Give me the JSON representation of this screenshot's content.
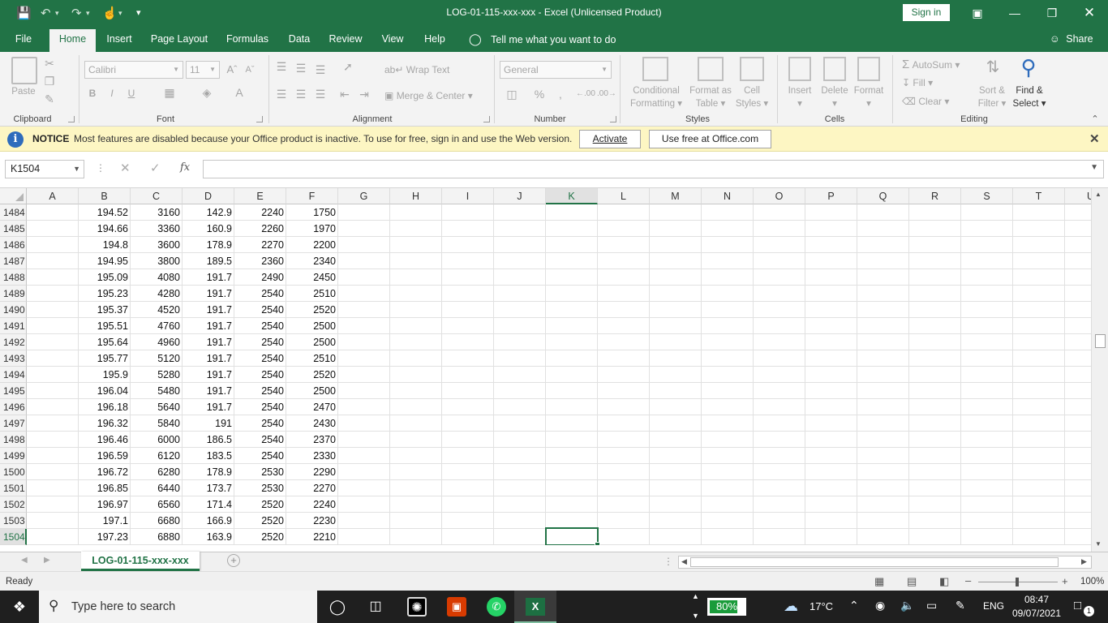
{
  "app": {
    "title": "LOG-01-115-xxx-xxx  -  Excel (Unlicensed Product)",
    "sign_in": "Sign in",
    "accent_color": "#217346"
  },
  "tabs": [
    "File",
    "Home",
    "Insert",
    "Page Layout",
    "Formulas",
    "Data",
    "Review",
    "View",
    "Help"
  ],
  "active_tab": "Home",
  "tell_me": "Tell me what you want to do",
  "share": "Share",
  "ribbon": {
    "clipboard": {
      "label": "Clipboard",
      "paste": "Paste"
    },
    "font": {
      "label": "Font",
      "name": "Calibri",
      "size": "11"
    },
    "alignment": {
      "label": "Alignment",
      "wrap": "Wrap Text",
      "merge": "Merge & Center"
    },
    "number": {
      "label": "Number",
      "format": "General"
    },
    "styles": {
      "label": "Styles",
      "cond1": "Conditional",
      "cond2": "Formatting",
      "fmt1": "Format as",
      "fmt2": "Table",
      "cell1": "Cell",
      "cell2": "Styles"
    },
    "cells": {
      "label": "Cells",
      "insert": "Insert",
      "delete": "Delete",
      "format": "Format"
    },
    "editing": {
      "label": "Editing",
      "autosum": "AutoSum",
      "fill": "Fill",
      "clear": "Clear",
      "sort1": "Sort &",
      "sort2": "Filter",
      "find1": "Find &",
      "find2": "Select"
    }
  },
  "notice": {
    "title": "NOTICE",
    "message": "Most features are disabled because your Office product is inactive. To use for free, sign in and use the Web version.",
    "activate": "Activate",
    "use_free": "Use free at Office.com"
  },
  "name_box": "K1504",
  "fx": "fx",
  "columns": [
    "A",
    "B",
    "C",
    "D",
    "E",
    "F",
    "G",
    "H",
    "I",
    "J",
    "K",
    "L",
    "M",
    "N",
    "O",
    "P",
    "Q",
    "R",
    "S",
    "T",
    "U"
  ],
  "selected_column": "K",
  "selected_row": "1504",
  "rows": [
    {
      "n": "1484",
      "B": "194.52",
      "C": "3160",
      "D": "142.9",
      "E": "2240",
      "F": "1750"
    },
    {
      "n": "1485",
      "B": "194.66",
      "C": "3360",
      "D": "160.9",
      "E": "2260",
      "F": "1970"
    },
    {
      "n": "1486",
      "B": "194.8",
      "C": "3600",
      "D": "178.9",
      "E": "2270",
      "F": "2200"
    },
    {
      "n": "1487",
      "B": "194.95",
      "C": "3800",
      "D": "189.5",
      "E": "2360",
      "F": "2340"
    },
    {
      "n": "1488",
      "B": "195.09",
      "C": "4080",
      "D": "191.7",
      "E": "2490",
      "F": "2450"
    },
    {
      "n": "1489",
      "B": "195.23",
      "C": "4280",
      "D": "191.7",
      "E": "2540",
      "F": "2510"
    },
    {
      "n": "1490",
      "B": "195.37",
      "C": "4520",
      "D": "191.7",
      "E": "2540",
      "F": "2520"
    },
    {
      "n": "1491",
      "B": "195.51",
      "C": "4760",
      "D": "191.7",
      "E": "2540",
      "F": "2500"
    },
    {
      "n": "1492",
      "B": "195.64",
      "C": "4960",
      "D": "191.7",
      "E": "2540",
      "F": "2500"
    },
    {
      "n": "1493",
      "B": "195.77",
      "C": "5120",
      "D": "191.7",
      "E": "2540",
      "F": "2510"
    },
    {
      "n": "1494",
      "B": "195.9",
      "C": "5280",
      "D": "191.7",
      "E": "2540",
      "F": "2520"
    },
    {
      "n": "1495",
      "B": "196.04",
      "C": "5480",
      "D": "191.7",
      "E": "2540",
      "F": "2500"
    },
    {
      "n": "1496",
      "B": "196.18",
      "C": "5640",
      "D": "191.7",
      "E": "2540",
      "F": "2470"
    },
    {
      "n": "1497",
      "B": "196.32",
      "C": "5840",
      "D": "191",
      "E": "2540",
      "F": "2430"
    },
    {
      "n": "1498",
      "B": "196.46",
      "C": "6000",
      "D": "186.5",
      "E": "2540",
      "F": "2370"
    },
    {
      "n": "1499",
      "B": "196.59",
      "C": "6120",
      "D": "183.5",
      "E": "2540",
      "F": "2330"
    },
    {
      "n": "1500",
      "B": "196.72",
      "C": "6280",
      "D": "178.9",
      "E": "2530",
      "F": "2290"
    },
    {
      "n": "1501",
      "B": "196.85",
      "C": "6440",
      "D": "173.7",
      "E": "2530",
      "F": "2270"
    },
    {
      "n": "1502",
      "B": "196.97",
      "C": "6560",
      "D": "171.4",
      "E": "2520",
      "F": "2240"
    },
    {
      "n": "1503",
      "B": "197.1",
      "C": "6680",
      "D": "166.9",
      "E": "2520",
      "F": "2230"
    },
    {
      "n": "1504",
      "B": "197.23",
      "C": "6880",
      "D": "163.9",
      "E": "2520",
      "F": "2210"
    }
  ],
  "sheet_tab": "LOG-01-115-xxx-xxx",
  "status": "Ready",
  "zoom": "100%",
  "taskbar": {
    "search_placeholder": "Type here to search",
    "battery": "80%",
    "battery_level": 0.8,
    "temperature": "17°C",
    "language": "ENG",
    "time": "08:47",
    "date": "09/07/2021",
    "notifications": "1"
  }
}
